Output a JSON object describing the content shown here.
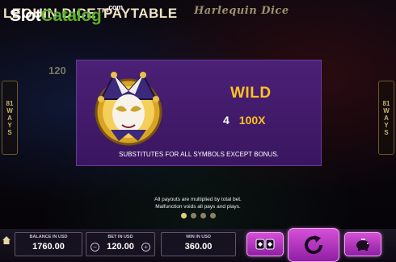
{
  "header": {
    "title_left": "LEQUIN DICE™",
    "title_right": "PAYTABLE",
    "logo_script": "Harlequin Dice",
    "watermark_part1": "Slot",
    "watermark_part2": "Catalog",
    "watermark_suffix": ".com"
  },
  "background": {
    "ways_number": "120",
    "ways_left": [
      "81",
      "W",
      "A",
      "Y",
      "S"
    ],
    "ways_right": [
      "81",
      "W",
      "A",
      "Y",
      "S"
    ]
  },
  "paytable": {
    "symbol_icon": "jester-mask-icon",
    "symbol_name": "WILD",
    "pays": [
      {
        "count": "4",
        "value": "100X"
      }
    ],
    "description": "SUBSTITUTES FOR ALL SYMBOLS EXCEPT BONUS."
  },
  "notices": [
    "All payouts are multiplied by total bet.",
    "Malfunction voids all pays and plays."
  ],
  "pagination": {
    "total": 4,
    "active": 1
  },
  "footer": {
    "balance_label": "BALANCE IN USD",
    "balance_value": "1760.00",
    "bet_label": "BET IN USD",
    "bet_value": "120.00",
    "win_label": "WIN IN USD",
    "win_value": "360.00"
  },
  "colors": {
    "accent_gold": "#ffc21f",
    "panel_purple": "#4b2076",
    "button_magenta": "#c23ec8",
    "brand_green": "#5ab227"
  }
}
